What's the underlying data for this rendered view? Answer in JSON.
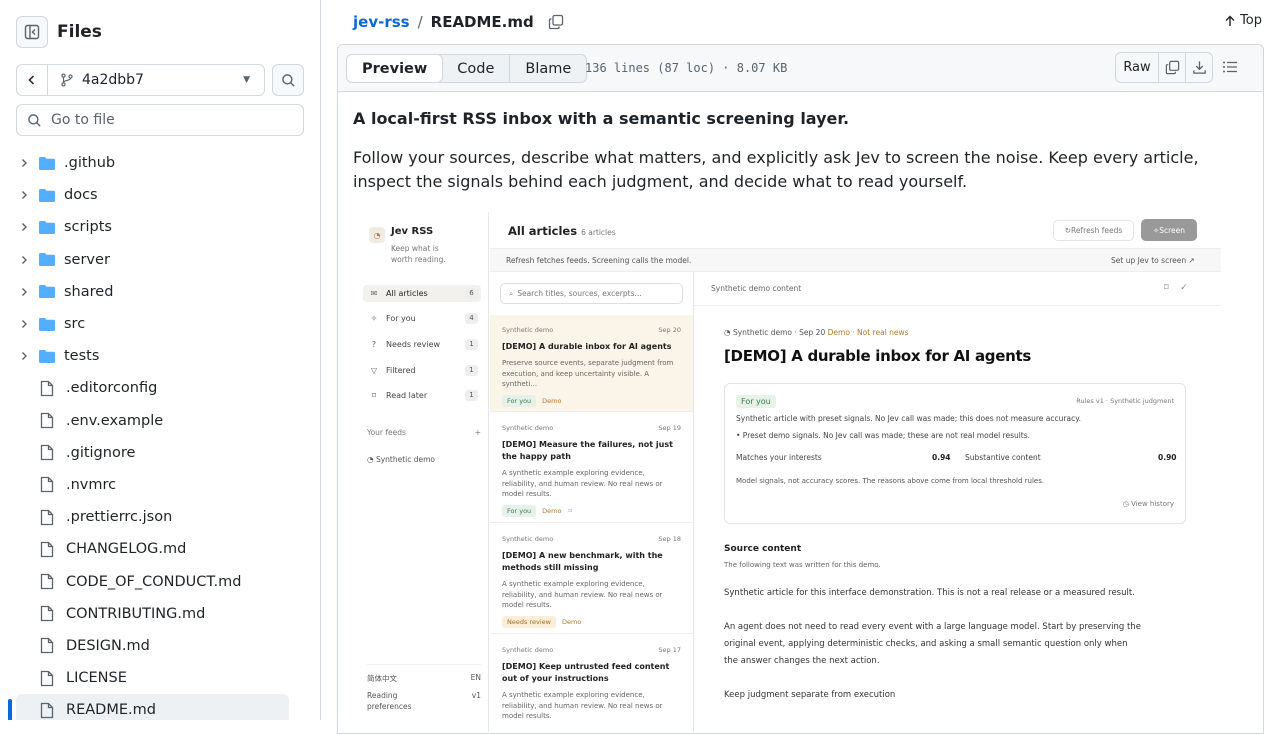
{
  "sidebar": {
    "title": "Files",
    "branch": "4a2dbb7",
    "goto_placeholder": "Go to file",
    "folders": [
      ".github",
      "docs",
      "scripts",
      "server",
      "shared",
      "src",
      "tests"
    ],
    "files": [
      ".editorconfig",
      ".env.example",
      ".gitignore",
      ".nvmrc",
      ".prettierrc.json",
      "CHANGELOG.md",
      "CODE_OF_CONDUCT.md",
      "CONTRIBUTING.md",
      "DESIGN.md",
      "LICENSE",
      "README.md"
    ]
  },
  "header": {
    "repo": "jev-rss",
    "sep": "/",
    "file": "README.md",
    "top_label": "Top"
  },
  "filebar": {
    "tabs": [
      "Preview",
      "Code",
      "Blame"
    ],
    "info": "136 lines (87 loc) · 8.07 KB",
    "raw_label": "Raw"
  },
  "readme": {
    "tagline": "A local-first RSS inbox with a semantic screening layer.",
    "paragraph": "Follow your sources, describe what matters, and explicitly ask Jev to screen the noise. Keep every article, inspect the signals behind each judgment, and decide what to read yourself."
  },
  "screenshot": {
    "app_name": "Jev RSS",
    "app_sub": "Keep what is worth reading.",
    "nav": [
      {
        "label": "All articles",
        "count": "6"
      },
      {
        "label": "For you",
        "count": "4"
      },
      {
        "label": "Needs review",
        "count": "1"
      },
      {
        "label": "Filtered",
        "count": "1"
      },
      {
        "label": "Read later",
        "count": "1"
      }
    ],
    "feeds_header": "Your feeds",
    "feeds_add": "+",
    "feed_item": "Synthetic demo",
    "lang_label": "简体中文",
    "lang_code": "EN",
    "prefs_label": "Reading preferences",
    "prefs_ver": "v1",
    "list_title": "All articles",
    "list_count": "6 articles",
    "refresh_label": "Refresh feeds",
    "screen_label": "Screen",
    "banner_left": "Refresh fetches feeds. Screening calls the model.",
    "banner_right": "Set up Jev to screen ↗",
    "search_placeholder": "Search titles, sources, excerpts...",
    "cards": [
      {
        "source": "Synthetic demo",
        "date": "Sep 20",
        "title": "[DEMO] A durable inbox for AI agents",
        "summary": "Preserve source events, separate judgment from execution, and keep uncertainty visible. A syntheti...",
        "tag": "For you",
        "demo": "Demo"
      },
      {
        "source": "Synthetic demo",
        "date": "Sep 19",
        "title": "[DEMO] Measure the failures, not just the happy path",
        "summary": "A synthetic example exploring evidence, reliability, and human review. No real news or model results.",
        "tag": "For you",
        "demo": "Demo"
      },
      {
        "source": "Synthetic demo",
        "date": "Sep 18",
        "title": "[DEMO] A new benchmark, with the methods still missing",
        "summary": "A synthetic example exploring evidence, reliability, and human review. No real news or model results.",
        "tag": "Needs review",
        "demo": "Demo"
      },
      {
        "source": "Synthetic demo",
        "date": "Sep 17",
        "title": "[DEMO] Keep untrusted feed content out of your instructions",
        "summary": "A synthetic example exploring evidence, reliability, and human review. No real news or model results.",
        "tag": "",
        "demo": ""
      }
    ],
    "detail": {
      "header": "Synthetic demo content",
      "meta_source": "Synthetic demo",
      "meta_date": "· Sep 20",
      "meta_note": "Demo · Not real news",
      "title": "[DEMO] A durable inbox for AI agents",
      "for_you": "For you",
      "rules": "Rules v1 · Synthetic judgment",
      "line1": "Synthetic article with preset signals. No Jev call was made; this does not measure accuracy.",
      "line2": "•  Preset demo signals. No Jev call was made; these are not real model results.",
      "m1_label": "Matches your interests",
      "m1_value": "0.94",
      "m2_label": "Substantive content",
      "m2_value": "0.90",
      "disclaimer": "Model signals, not accuracy scores. The reasons above come from local threshold rules.",
      "view_history": "◷ View history",
      "source_heading": "Source content",
      "source_sub": "The following text was written for this demo.",
      "body1": "Synthetic article for this interface demonstration. This is not a real release or a measured result.",
      "body2": "An agent does not need to read every event with a large language model. Start by preserving the original event, applying deterministic checks, and asking a small semantic question only when the answer changes the next action.",
      "body3": "Keep judgment separate from execution"
    }
  }
}
